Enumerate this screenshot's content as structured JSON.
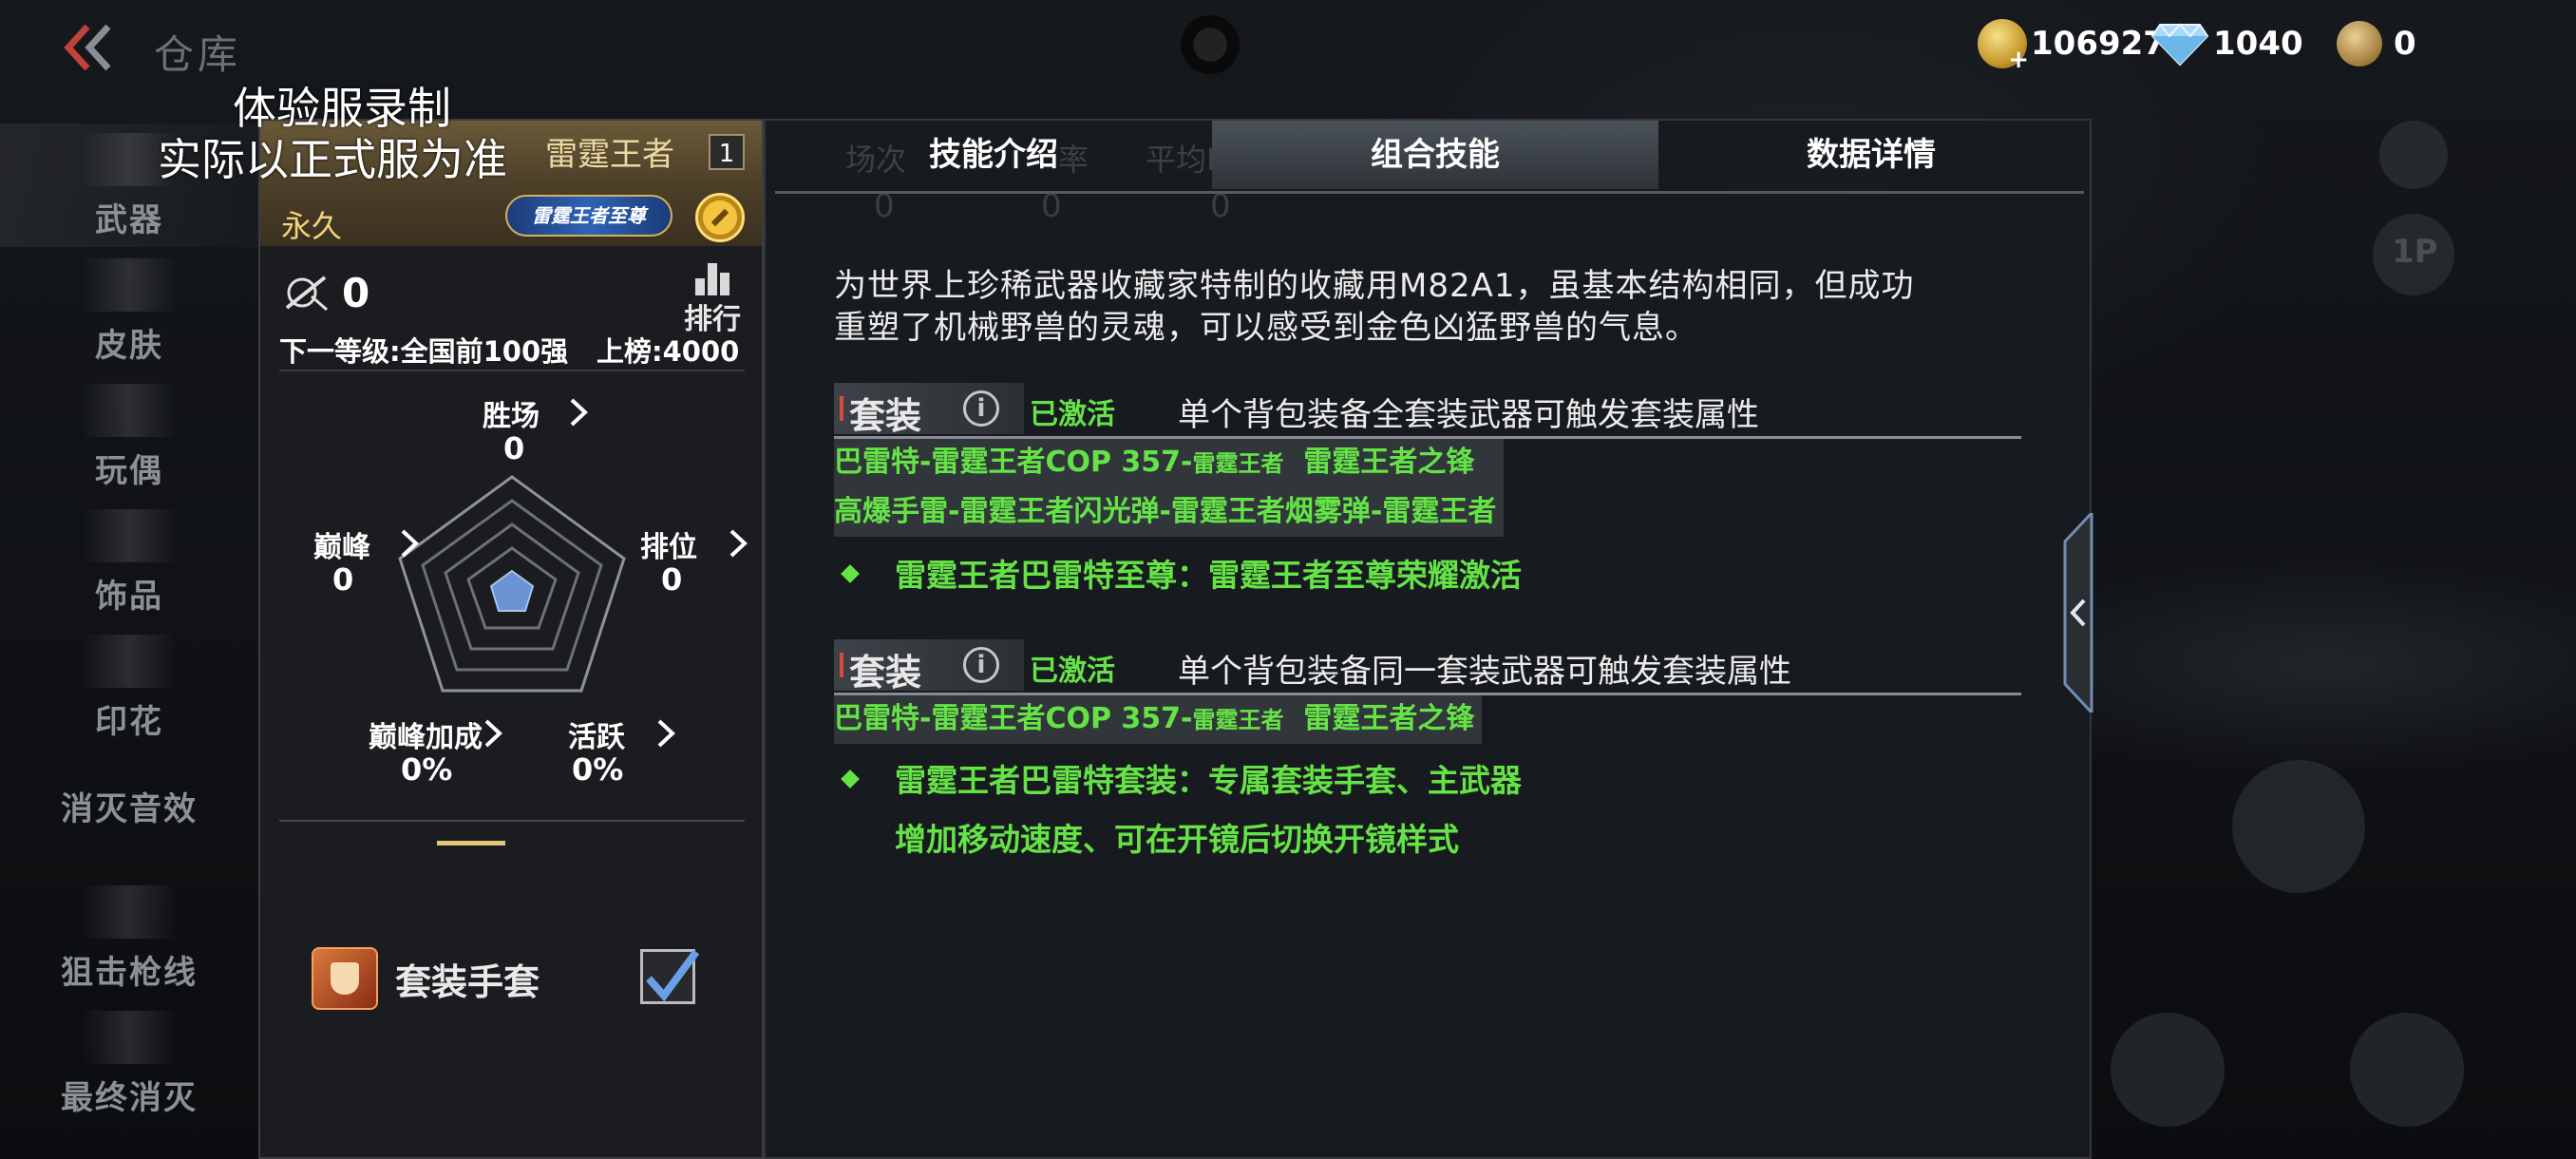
{
  "topbar": {
    "title": "仓库",
    "watermark_line1": "体验服录制",
    "watermark_line2": "实际以正式服为准",
    "gold": "106927",
    "diamonds": "1040",
    "tickets": "0",
    "icons": [
      "back-chevron-icon",
      "gold-coin-icon",
      "diamond-icon",
      "ticket-icon"
    ]
  },
  "sidebar": {
    "items": [
      {
        "label": "武器"
      },
      {
        "label": "皮肤"
      },
      {
        "label": "玩偶"
      },
      {
        "label": "饰品"
      },
      {
        "label": "印花"
      },
      {
        "label": "消灭音效"
      },
      {
        "label": "狙击枪线"
      },
      {
        "label": "最终消灭"
      }
    ]
  },
  "weapon": {
    "name": "雷霆王者",
    "count": "1",
    "duration": "永久",
    "rank_chip": "雷霆王者至尊",
    "kills": "0",
    "rank_btn": "排行",
    "next_level": "下一等级:全国前100强",
    "board": "上榜:4000",
    "stats": {
      "wins_label": "胜场",
      "wins_val": "0",
      "peak_label": "巅峰",
      "peak_val": "0",
      "ranked_label": "排位",
      "ranked_val": "0",
      "peak_bonus_label": "巅峰加成",
      "peak_bonus_val": "0%",
      "active_label": "活跃",
      "active_val": "0%"
    },
    "gloves_label": "套装手套",
    "gloves_checked": true
  },
  "tabs": {
    "items": [
      {
        "label": "技能介绍",
        "active": false
      },
      {
        "label": "组合技能",
        "active": true
      },
      {
        "label": "数据详情",
        "active": false
      }
    ],
    "ghost": {
      "matches": "场次",
      "rate": "率",
      "kda": "平均KDA",
      "n1": "0",
      "n2": "0",
      "n3": "0"
    }
  },
  "description": "为世界上珍稀武器收藏家特制的收藏用M82A1，虽基本结构相同，但成功重塑了机械野兽的灵魂，可以感受到金色凶猛野兽的气息。",
  "sets": [
    {
      "tag": "套装",
      "status": "已激活",
      "desc": "单个背包装备全套装武器可触发套装属性",
      "members": [
        {
          "a": "巴雷特-雷霆王者COP 357-",
          "small": "雷霆王者",
          "b": "  雷霆王者之锋"
        },
        {
          "a": "高爆手雷-雷霆王者闪光弹-雷霆王者烟雾弹-雷霆王者",
          "small": "",
          "b": ""
        }
      ],
      "bonuses": [
        "雷霆王者巴雷特至尊：雷霆王者至尊荣耀激活"
      ]
    },
    {
      "tag": "套装",
      "status": "已激活",
      "desc": "单个背包装备同一套装武器可触发套装属性",
      "members": [
        {
          "a": "巴雷特-雷霆王者COP 357-",
          "small": "雷霆王者",
          "b": "  雷霆王者之锋"
        }
      ],
      "bonuses": [
        "雷霆王者巴雷特套装：专属套装手套、主武器",
        "增加移动速度、可在开镜后切换开镜样式"
      ]
    }
  ],
  "colors": {
    "accent_green": "#65e346",
    "gold": "#f2d47a",
    "panel": "#1a1c20"
  },
  "ghost_controls": {
    "label_1p": "1P"
  }
}
